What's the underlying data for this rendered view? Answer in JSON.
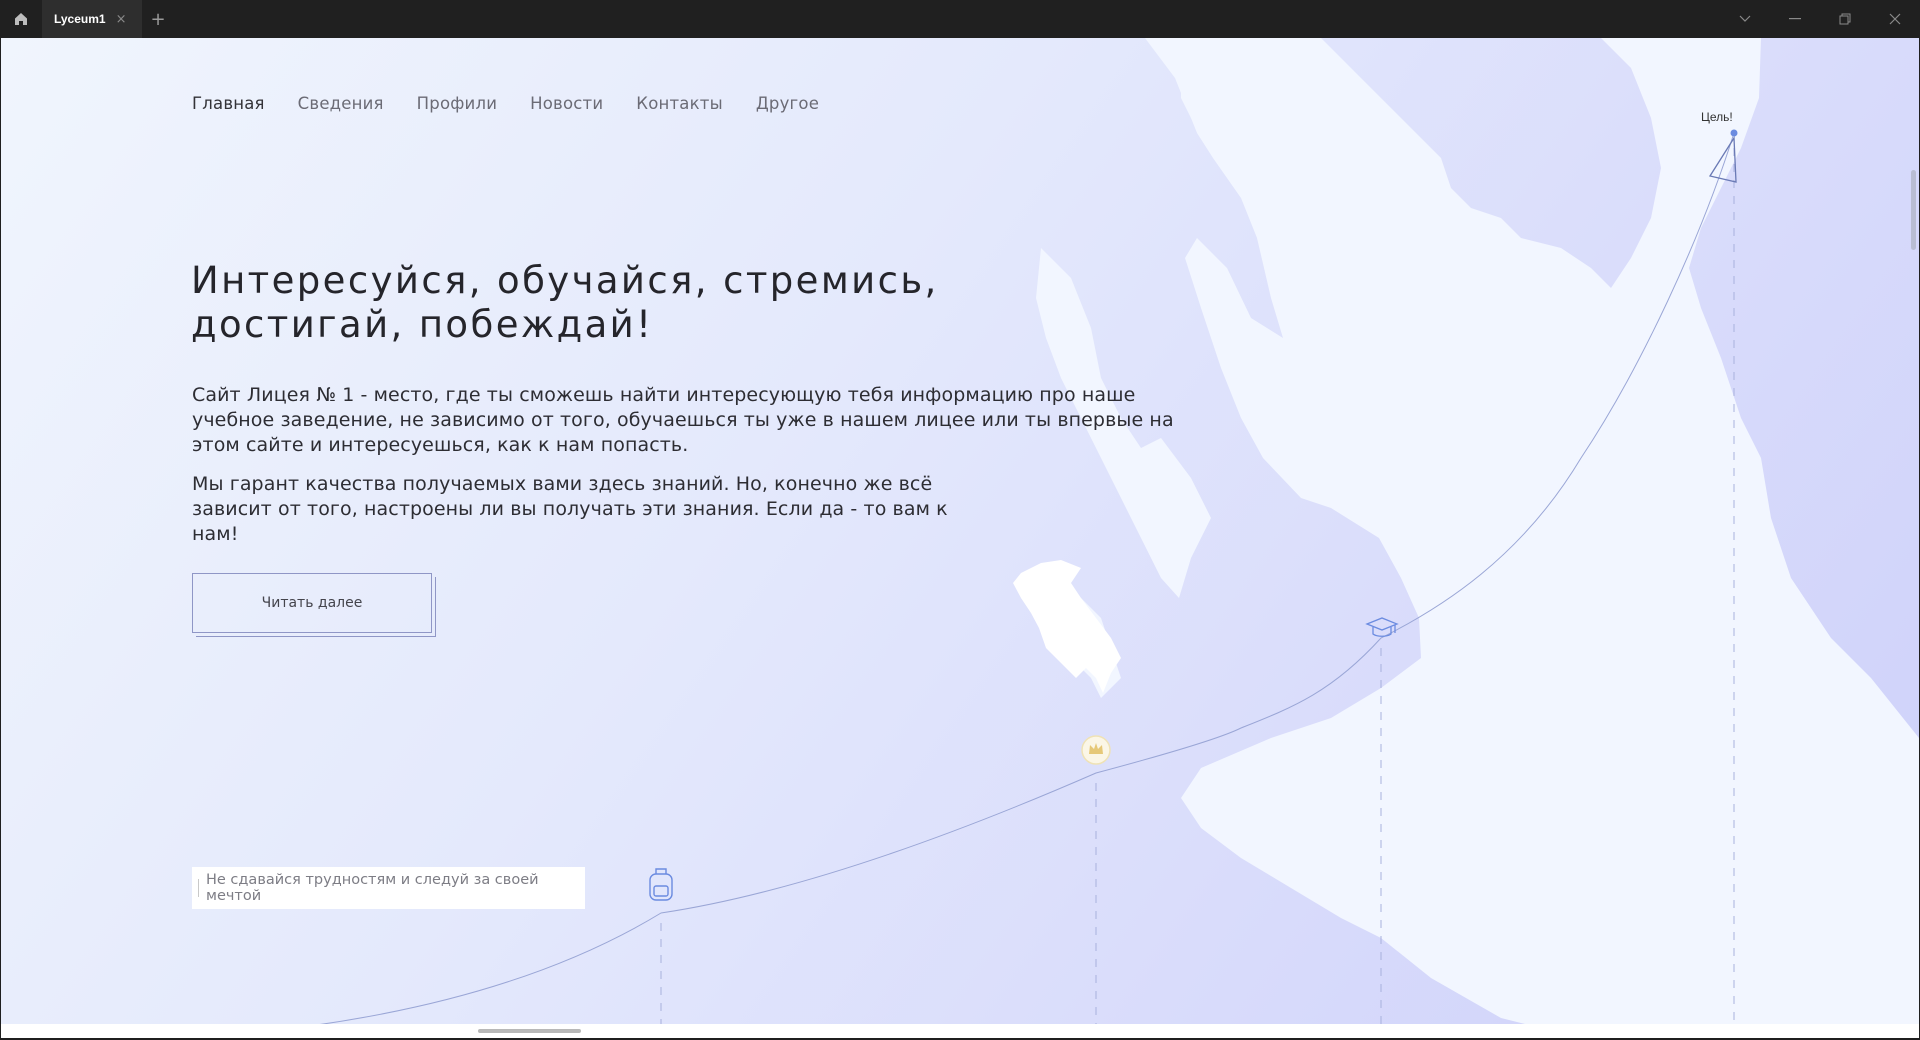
{
  "window": {
    "tab_title": "Lyceum1",
    "tab_close": "×",
    "new_tab": "+"
  },
  "nav": {
    "items": [
      "Главная",
      "Сведения",
      "Профили",
      "Новости",
      "Контакты",
      "Другое"
    ],
    "active_index": 0
  },
  "hero": {
    "title_line1": "Интересуйся, обучайся, стремись,",
    "title_line2": "достигай, побеждай!",
    "paragraph1": "Сайт Лицея № 1 - место, где ты сможешь найти интересующую тебя информацию про наше учебное заведение, не зависимо от того, обучаешься ты уже в нашем лицее или ты впервые на этом сайте и интересуешься, как к нам попасть.",
    "paragraph2": "Мы гарант качества получаемых вами здесь знаний. Но, конечно же всё зависит от того, настроены ли вы получать эти знания. Если да - то вам к нам!",
    "button_label": "Читать далее"
  },
  "path": {
    "motto": "Не сдавайся трудностям и следуй за своей мечтой",
    "goal_label": "Цель!",
    "milestones": [
      "backpack-icon",
      "crown-icon",
      "graduation-cap-icon",
      "flag-icon"
    ]
  },
  "colors": {
    "map_land": "#f2f6ff",
    "map_water": "#d3d7fb",
    "path_line": "#9aa6d6",
    "accent_blue": "#6b8be0",
    "crown_gold": "#e6c878"
  }
}
